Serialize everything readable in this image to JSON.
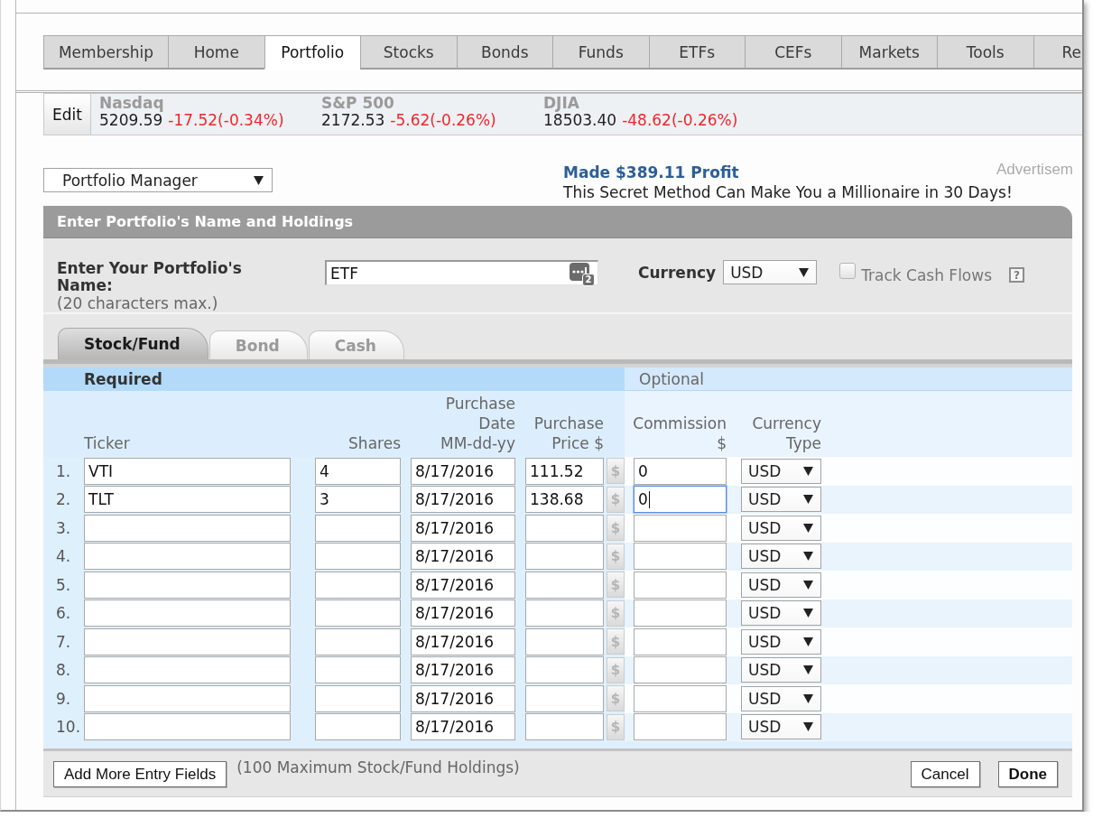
{
  "nav_tabs": [
    {
      "label": "Membership",
      "selected": false
    },
    {
      "label": "Home",
      "selected": false
    },
    {
      "label": "Portfolio",
      "selected": true
    },
    {
      "label": "Stocks",
      "selected": false
    },
    {
      "label": "Bonds",
      "selected": false
    },
    {
      "label": "Funds",
      "selected": false
    },
    {
      "label": "ETFs",
      "selected": false
    },
    {
      "label": "CEFs",
      "selected": false
    },
    {
      "label": "Markets",
      "selected": false
    },
    {
      "label": "Tools",
      "selected": false
    },
    {
      "label": "Re",
      "selected": false
    }
  ],
  "ticker_bar": {
    "edit_button": "Edit",
    "indices": [
      {
        "name": "Nasdaq",
        "value": "5209.59",
        "change": "-17.52(-0.34%)"
      },
      {
        "name": "S&P 500",
        "value": "2172.53",
        "change": "-5.62(-0.26%)"
      },
      {
        "name": "DJIA",
        "value": "18503.40",
        "change": "-48.62(-0.26%)"
      }
    ]
  },
  "portfolio_menu": {
    "value": "Portfolio Manager"
  },
  "ad": {
    "headline": "Made $389.11 Profit",
    "text": "This Secret Method Can Make You a Millionaire in 30 Days!",
    "label": "Advertisem"
  },
  "panel": {
    "title": "Enter Portfolio's Name and Holdings",
    "name_field": {
      "label": "Enter Your Portfolio's Name:",
      "hint": "(20 characters max.)",
      "value": "ETF",
      "badge": "2"
    },
    "currency": {
      "label": "Currency",
      "value": "USD"
    },
    "track_cash_flows": {
      "label": "Track Cash Flows",
      "checked": false
    },
    "help": "?",
    "asset_tabs": [
      {
        "label": "Stock/Fund",
        "selected": true
      },
      {
        "label": "Bond",
        "selected": false
      },
      {
        "label": "Cash",
        "selected": false
      }
    ],
    "holdings": {
      "required_label": "Required",
      "optional_label": "Optional",
      "headers": {
        "ticker": "Ticker",
        "shares": "Shares",
        "date": "Purchase Date MM-dd-yy",
        "price": "Purchase Price $",
        "commission": "Commission $",
        "currency": "Currency Type"
      },
      "rows": [
        {
          "number": "1.",
          "ticker": "VTI",
          "shares": "4",
          "date": "8/17/2016",
          "price": "111.52",
          "price_tool": "$",
          "commission": "0",
          "commission_focused": false,
          "currency": "USD"
        },
        {
          "number": "2.",
          "ticker": "TLT",
          "shares": "3",
          "date": "8/17/2016",
          "price": "138.68",
          "price_tool": "$",
          "commission": "0",
          "commission_focused": true,
          "currency": "USD"
        },
        {
          "number": "3.",
          "date": "8/17/2016",
          "price_tool": "$",
          "commission_focused": false,
          "currency": "USD"
        },
        {
          "number": "4.",
          "date": "8/17/2016",
          "price_tool": "$",
          "commission_focused": false,
          "currency": "USD"
        },
        {
          "number": "5.",
          "date": "8/17/2016",
          "price_tool": "$",
          "commission_focused": false,
          "currency": "USD"
        },
        {
          "number": "6.",
          "date": "8/17/2016",
          "price_tool": "$",
          "commission_focused": false,
          "currency": "USD"
        },
        {
          "number": "7.",
          "date": "8/17/2016",
          "price_tool": "$",
          "commission_focused": false,
          "currency": "USD"
        },
        {
          "number": "8.",
          "date": "8/17/2016",
          "price_tool": "$",
          "commission_focused": false,
          "currency": "USD"
        },
        {
          "number": "9.",
          "date": "8/17/2016",
          "price_tool": "$",
          "commission_focused": false,
          "currency": "USD"
        },
        {
          "number": "10.",
          "date": "8/17/2016",
          "price_tool": "$",
          "commission_focused": false,
          "currency": "USD"
        }
      ]
    },
    "footer": {
      "add_button": "Add More Entry Fields",
      "note": "(100 Maximum Stock/Fund Holdings)",
      "cancel_button": "Cancel",
      "done_button": "Done"
    }
  }
}
